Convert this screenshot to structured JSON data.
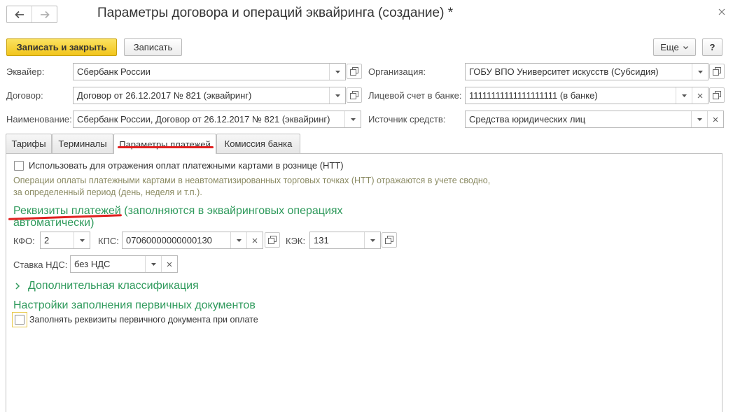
{
  "window": {
    "title": "Параметры договора и операций эквайринга (создание) *",
    "back_icon": "arrow-left-icon",
    "forward_icon": "arrow-right-icon",
    "close_icon": "close-icon"
  },
  "toolbar": {
    "save_close_label": "Записать и закрыть",
    "save_label": "Записать",
    "more_label": "Еще",
    "help_label": "?"
  },
  "header_fields": {
    "acquirer": {
      "label": "Эквайер:",
      "value": "Сбербанк России"
    },
    "contract": {
      "label": "Договор:",
      "value": "Договор от 26.12.2017 № 821 (эквайринг)"
    },
    "name": {
      "label": "Наименование:",
      "value": "Сбербанк России, Договор от 26.12.2017 № 821 (эквайринг)"
    },
    "organization": {
      "label": "Организация:",
      "value": "ГОБУ ВПО Университет искусств (Субсидия)"
    },
    "account": {
      "label": "Лицевой счет в банке:",
      "value": "11111111111111111111 (в банке)"
    },
    "source": {
      "label": "Источник средств:",
      "value": "Средства юридических лиц"
    }
  },
  "tabs": [
    {
      "label": "Тарифы"
    },
    {
      "label": "Терминалы"
    },
    {
      "label": "Параметры платежей",
      "active": true
    },
    {
      "label": "Комиссия банка"
    }
  ],
  "payments_tab": {
    "retail_checkbox_label": "Использовать для отражения оплат платежными картами в рознице (НТТ)",
    "retail_hint_line1": "Операции оплаты платежными картами в неавтоматизированных торговых точках (НТТ) отражаются в учете сводно,",
    "retail_hint_line2": "за определенный период (день, неделя и т.п.).",
    "requisites_heading_line1": "Реквизиты платежей (заполняются в эквайринговых операциях",
    "requisites_heading_line2": "автоматически)",
    "kfo": {
      "label": "КФО:",
      "value": "2"
    },
    "kps": {
      "label": "КПС:",
      "value": "07060000000000130"
    },
    "kek": {
      "label": "КЭК:",
      "value": "131"
    },
    "vat": {
      "label": "Ставка НДС:",
      "value": "без НДС"
    },
    "extra_classification_label": "Дополнительная классификация",
    "primary_docs_heading": "Настройки заполнения первичных документов",
    "primary_docs_checkbox_label": "Заполнять реквизиты первичного документа при оплате"
  },
  "colors": {
    "primary_button": "#f2c51c",
    "heading_green": "#2f9a5c",
    "hint_text": "#8a8a62",
    "annotation_red": "#e02020"
  }
}
